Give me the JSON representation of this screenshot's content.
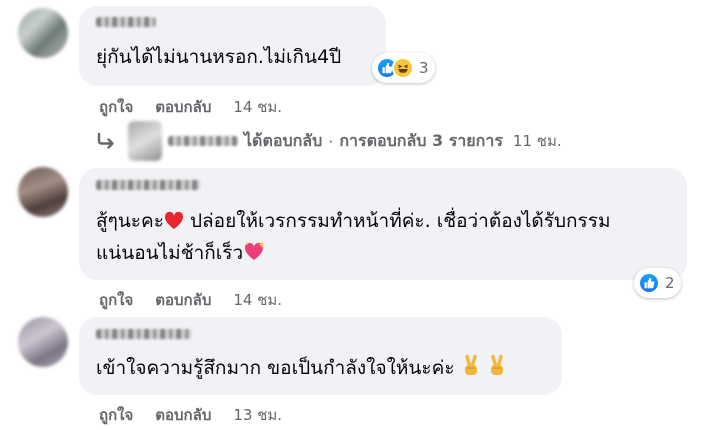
{
  "comments": [
    {
      "text": "ยุ่กันได้ไม่นานหรอก.ไม่เกิน4ปี",
      "reaction_count": "3",
      "like_label": "ถูกใจ",
      "reply_label": "ตอบกลับ",
      "time": "14 ชม."
    },
    {
      "line1_a": "สู้ๆนะคะ",
      "line1_b": " ปล่อยให้เวรกรรมทำหน้าที่ค่ะ. เชื่อว่าต้องได้รับกรรม",
      "line2": "แน่นอนไม่ช้าก็เร็ว",
      "reaction_count": "2",
      "like_label": "ถูกใจ",
      "reply_label": "ตอบกลับ",
      "time": "14 ชม."
    },
    {
      "text": "เข้าใจความรู้สึกมาก ขอเป็นกำลังใจให้นะค่ะ",
      "like_label": "ถูกใจ",
      "reply_label": "ตอบกลับ",
      "time": "13 ชม."
    }
  ],
  "replies_link": {
    "replied_text": "ได้ตอบกลับ",
    "separator": "·",
    "count_text": "การตอบกลับ 3 รายการ",
    "time": "11 ชม."
  },
  "icons": {
    "like": "like-icon",
    "haha": "haha-icon",
    "heart": "heart-icon",
    "sparkling_heart": "sparkling-heart-icon",
    "victory_hand": "victory-hand-icon",
    "reply_arrow": "reply-arrow-icon"
  },
  "colors": {
    "bubble": "#f0f2f5",
    "secondary_text": "#65676b",
    "like_blue": "#1877f2"
  }
}
